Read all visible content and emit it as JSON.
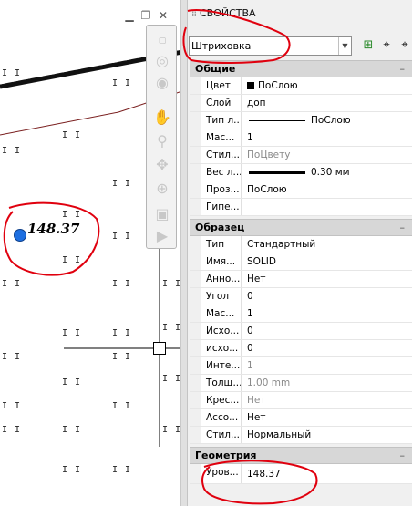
{
  "canvas": {
    "hatch_text": "148.37",
    "pattern_mark": "I I",
    "colors": {
      "hatch_line": "#111111",
      "boundary": "#7a1f1f",
      "grip": "#1e6fe0",
      "annotation": "#e0000e"
    }
  },
  "navbar": {
    "icons": [
      "steering-wheel-icon",
      "orbit-icon",
      "pan-hand-icon",
      "zoom-icon",
      "orbit-3d-icon",
      "rewind-icon",
      "showmotion-icon"
    ]
  },
  "palette": {
    "title": "СВОЙСТВА",
    "selector_value": "Штриховка",
    "sections": [
      {
        "title": "Общие",
        "rows": [
          {
            "name": "Цвет",
            "value": "ПоСлою",
            "kind": "color"
          },
          {
            "name": "Слой",
            "value": "доп"
          },
          {
            "name": "Тип л...",
            "value": "ПоСлою",
            "kind": "linetype"
          },
          {
            "name": "Мас...",
            "value": "1"
          },
          {
            "name": "Стил...",
            "value": "ПоЦвету",
            "disabled": true
          },
          {
            "name": "Вес л...",
            "value": "0.30 мм",
            "kind": "lineweight"
          },
          {
            "name": "Проз...",
            "value": "ПоСлою"
          },
          {
            "name": "Гипе...",
            "value": ""
          }
        ]
      },
      {
        "title": "Образец",
        "rows": [
          {
            "name": "Тип",
            "value": "Стандартный"
          },
          {
            "name": "Имя...",
            "value": "SOLID"
          },
          {
            "name": "Анно...",
            "value": "Нет"
          },
          {
            "name": "Угол",
            "value": "0"
          },
          {
            "name": "Мас...",
            "value": "1"
          },
          {
            "name": "Исхо...",
            "value": "0"
          },
          {
            "name": "исхо...",
            "value": "0"
          },
          {
            "name": "Инте...",
            "value": "1",
            "disabled": true
          },
          {
            "name": "Толщ...",
            "value": "1.00 mm",
            "disabled": true
          },
          {
            "name": "Крес...",
            "value": "Нет",
            "disabled": true
          },
          {
            "name": "Ассо...",
            "value": "Нет"
          },
          {
            "name": "Стил...",
            "value": "Нормальный"
          }
        ]
      },
      {
        "title": "Геометрия",
        "rows": [
          {
            "name": "Уров...",
            "value": "148.37"
          }
        ]
      }
    ]
  }
}
